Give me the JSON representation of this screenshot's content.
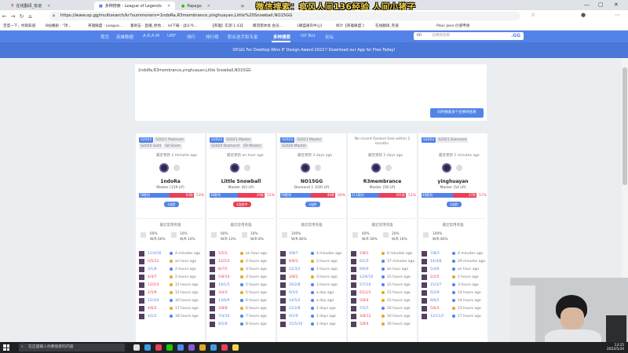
{
  "browser": {
    "tabs": [
      {
        "label": "在线翻译_有道",
        "icon": "youdao-icon",
        "color": "#e84057",
        "active": false
      },
      {
        "label": "多种搜索 - League of Legends",
        "icon": "opgg-icon",
        "color": "#5383e8",
        "active": true
      },
      {
        "label": "Papago",
        "icon": "papago-icon",
        "color": "#1ec800",
        "active": false
      }
    ],
    "banner_text": "微信搜索：疯风人间136经验 人间小猪子",
    "url": "https://www.op.gg/multisearch/kr?summoners=1ndoRa,R3membrance,yinghuayan,Little%20Snowball,NO15GG",
    "bookmarks": [
      "百度一下，你就知道",
      "B站番剧 - \"顶...",
      "英雄联盟 - League...",
      "着射击 - 直播_绝地...",
      "lol下载 - 战斗今...",
      "【英雄】实测 1.43】",
      "鹰羽客体会 会员...",
      "《联盟通讯中心》",
      "统计【英雄联盟 》",
      "在线翻译_有道",
      "Plain Jane 价值申请"
    ]
  },
  "site_nav": {
    "items": [
      "首页",
      "英雄数据",
      "A.R.A.M",
      "URF",
      "排行",
      "排行榜",
      "职业选手和专家",
      "多种搜索",
      "OP Bot",
      "论坛"
    ],
    "active_index": 7,
    "search_region": "KR",
    "search_placeholder": "召唤师名称",
    "search_logo": ".GG"
  },
  "promo": "OP.GG For Desktop Wins iF Design Award 2022!! Download our App for Free Today!",
  "input_text": "1ndoRa,R3membrance,yinghuayan,Little Snowball,NO15GG",
  "search_button": "同时搜索多个召唤师名称",
  "players": [
    {
      "name": "1ndoRa",
      "seasons": [
        "S2022",
        "S2021 Platinum",
        "S2020 Gold",
        "S8 Silver"
      ],
      "updated": "最近更新 2 minutes ago",
      "rank": "Master (159 LP)",
      "wins": "78胜利",
      "losses": "64败",
      "winrate": "53%",
      "tag": "3连胜",
      "tag_loss": false,
      "wr_fraction": 0.55,
      "most_label": "最近常用英雄",
      "stat1": "60%",
      "stat1b": "W/R 60%",
      "stat2": "10%",
      "stat2b": "W/R 10%",
      "games": [
        {
          "kda": "11/4/16",
          "win": true,
          "time": "4 minutes ago"
        },
        {
          "kda": "0/5/12",
          "win": false,
          "time": "an hour ago"
        },
        {
          "kda": "3/1/8",
          "win": true,
          "time": "2 hours ago"
        },
        {
          "kda": "4/4/7",
          "win": false,
          "time": "2 hours ago"
        },
        {
          "kda": "12/5/3",
          "win": false,
          "time": "15 hours ago"
        },
        {
          "kda": "2/5/9",
          "win": false,
          "time": "15 hours ago"
        },
        {
          "kda": "12/3/4",
          "win": true,
          "time": "16 hours ago"
        },
        {
          "kda": "4/6/2",
          "win": false,
          "time": "17 hours ago"
        },
        {
          "kda": "4/1/2",
          "win": true,
          "time": "18 hours ago"
        }
      ]
    },
    {
      "name": "Little Snowball",
      "seasons": [
        "S2022",
        "S2021 Master",
        "S2020 Diamond",
        "S9 Master"
      ],
      "updated": "最近更新 an hour ago",
      "rank": "Master (63 LP)",
      "wins": "30胜利",
      "losses": "29败",
      "winrate": "51%",
      "tag": "3连败中",
      "tag_loss": true,
      "wr_fraction": 0.51,
      "most_label": "最近常用英雄",
      "stat1": "60%",
      "stat1b": "W/R 13%",
      "stat2": "10%",
      "stat2b": "W/R 8%",
      "games": [
        {
          "kda": "5/5/2",
          "win": false,
          "time": "an hour ago"
        },
        {
          "kda": "12/5/3",
          "win": false,
          "time": "2 hours ago"
        },
        {
          "kda": "8/7/5",
          "win": false,
          "time": "3 hours ago"
        },
        {
          "kda": "5/8/14",
          "win": false,
          "time": "3 hours ago"
        },
        {
          "kda": "10/1/5",
          "win": true,
          "time": "5 hours ago"
        },
        {
          "kda": "3/4/3",
          "win": false,
          "time": "5 hours ago"
        },
        {
          "kda": "13/6/9",
          "win": true,
          "time": "6 hours ago"
        },
        {
          "kda": "3/8/8",
          "win": false,
          "time": "6 hours ago"
        },
        {
          "kda": "7/4/10",
          "win": true,
          "time": "7 hours ago"
        },
        {
          "kda": "8/5/8",
          "win": true,
          "time": "8 hours ago"
        }
      ]
    },
    {
      "name": "NO15GG",
      "seasons": [
        "S2022",
        "S2021 Master",
        "S2020 Master"
      ],
      "updated": "最近更新 3 days ago",
      "rank": "Diamond 1 (100 LP)",
      "wins": "59胜利",
      "losses": "46败",
      "winrate": "56%",
      "tag": "3连胜",
      "tag_loss": false,
      "wr_fraction": 0.56,
      "most_label": "最近常用英雄",
      "stat1": "100%",
      "stat1b": "W/R 80%",
      "stat2": "",
      "stat2b": "",
      "games": [
        {
          "kda": "9/8/7",
          "win": true,
          "time": "4 minutes ago"
        },
        {
          "kda": "6/6/3",
          "win": false,
          "time": "2 hours ago"
        },
        {
          "kda": "12/3/2",
          "win": true,
          "time": "2 hours ago"
        },
        {
          "kda": "2/8/2",
          "win": false,
          "time": "3 hours ago"
        },
        {
          "kda": "10/2/8",
          "win": true,
          "time": "3 hours ago"
        },
        {
          "kda": "6/5/5",
          "win": true,
          "time": "a day ago"
        },
        {
          "kda": "14/5/2",
          "win": true,
          "time": "a day ago"
        },
        {
          "kda": "12/2/8",
          "win": true,
          "time": "2 days ago"
        },
        {
          "kda": "9/1/9",
          "win": true,
          "time": "2 days ago"
        },
        {
          "kda": "15/5/10",
          "win": true,
          "time": "2 days ago"
        }
      ]
    },
    {
      "name": "R3membrance",
      "seasons": [],
      "no_history": "No recent Ranked Solo within 2 months.",
      "updated": "最近更新 2 days ago",
      "rank": "Master (58 LP)",
      "wins": "211胜利",
      "losses": "201败",
      "winrate": "51%",
      "tag": "",
      "tag_loss": false,
      "wr_fraction": 0.51,
      "most_label": "最近常用英雄",
      "stat1": "60%",
      "stat1b": "W/R 30%",
      "stat2": "20%",
      "stat2b": "W/R 10%",
      "games": [
        {
          "kda": "2/8/1",
          "win": false,
          "time": "6 minutes ago"
        },
        {
          "kda": "6/1/5",
          "win": true,
          "time": "37 minutes ago"
        },
        {
          "kda": "8/6/6",
          "win": true,
          "time": "an hour ago"
        },
        {
          "kda": "12/6/10",
          "win": true,
          "time": "15 hours ago"
        },
        {
          "kda": "5/7/10",
          "win": true,
          "time": "15 hours ago"
        },
        {
          "kda": "6/12/1",
          "win": false,
          "time": "15 hours ago"
        },
        {
          "kda": "5/8/4",
          "win": false,
          "time": "15 hours ago"
        },
        {
          "kda": "7/5/7",
          "win": true,
          "time": "16 hours ago"
        },
        {
          "kda": "3/8/12",
          "win": false,
          "time": "16 hours ago"
        },
        {
          "kda": "5/8/4",
          "win": false,
          "time": "16 hours ago"
        }
      ]
    },
    {
      "name": "yinghuayan",
      "seasons": [
        "S2022",
        "S2021 Diamond"
      ],
      "updated": "最近更新 5 minutes ago",
      "rank": "Master (54 LP)",
      "wins": "46胜利",
      "losses": "37败",
      "winrate": "57%",
      "tag": "3连胜",
      "tag_loss": false,
      "wr_fraction": 0.57,
      "most_label": "最近常用英雄",
      "stat1": "100%",
      "stat1b": "W/R 80%",
      "stat2": "",
      "stat2b": "",
      "games": [
        {
          "kda": "7/8/3",
          "win": true,
          "time": "4 minutes ago"
        },
        {
          "kda": "14/4/8",
          "win": true,
          "time": "29 minutes ago"
        },
        {
          "kda": "5/4/6",
          "win": true,
          "time": "an hour ago"
        },
        {
          "kda": "2/2/5",
          "win": false,
          "time": "2 hours ago"
        },
        {
          "kda": "15/3/7",
          "win": true,
          "time": "3 hours ago"
        },
        {
          "kda": "6/2/9",
          "win": true,
          "time": "14 hours ago"
        },
        {
          "kda": "8/6/5",
          "win": true,
          "time": "14 hours ago"
        },
        {
          "kda": "5/6/3",
          "win": false,
          "time": "15 hours ago"
        },
        {
          "kda": "12/11/2",
          "win": true,
          "time": "17 hours ago"
        }
      ]
    }
  ],
  "taskbar": {
    "search_placeholder": "在这里输入你要搜索的内容",
    "time": "13:15",
    "date": "2022/5/24"
  }
}
